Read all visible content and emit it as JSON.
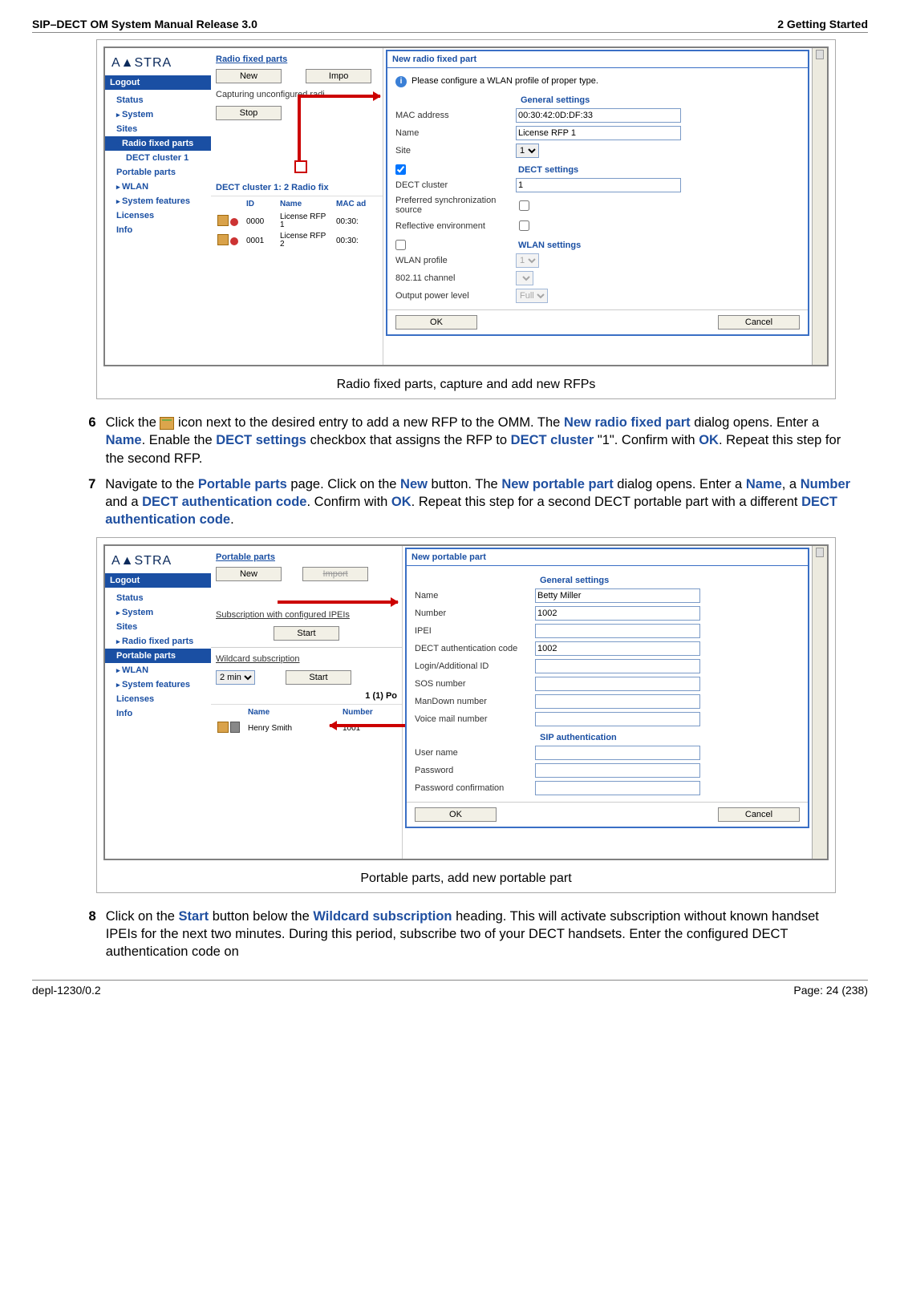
{
  "header": {
    "left": "SIP–DECT OM System Manual Release 3.0",
    "right": "2 Getting Started"
  },
  "footer": {
    "left": "depl-1230/0.2",
    "right": "Page: 24 (238)"
  },
  "fig1": {
    "caption": "Radio fixed parts, capture and add new RFPs",
    "brand": "A▲STRA",
    "logout": "Logout",
    "nav": {
      "status": "Status",
      "system": "System",
      "sites": "Sites",
      "rfp": "Radio fixed parts",
      "dect1": "DECT cluster 1",
      "pp": "Portable parts",
      "wlan": "WLAN",
      "sf": "System features",
      "lic": "Licenses",
      "info": "Info"
    },
    "mid": {
      "title": "Radio fixed parts",
      "new": "New",
      "import": "Impo",
      "capturing": "Capturing unconfigured radi",
      "stop": "Stop",
      "cluster_title": "DECT cluster 1: 2 Radio fix",
      "hdr_id": "ID",
      "hdr_name": "Name",
      "hdr_mac": "MAC ad",
      "rows": [
        {
          "id": "0000",
          "name": "License RFP 1",
          "mac": "00:30:"
        },
        {
          "id": "0001",
          "name": "License RFP 2",
          "mac": "00:30:"
        }
      ]
    },
    "dlg": {
      "title": "New radio fixed part",
      "info": "Please configure a WLAN profile of proper type.",
      "general": "General settings",
      "mac_l": "MAC address",
      "mac_v": "00:30:42:0D:DF:33",
      "name_l": "Name",
      "name_v": "License RFP 1",
      "site_l": "Site",
      "site_v": "1",
      "dect": "DECT settings",
      "cluster_l": "DECT cluster",
      "cluster_v": "1",
      "pref_l": "Preferred synchronization source",
      "refl_l": "Reflective environment",
      "wlan": "WLAN settings",
      "wp_l": "WLAN profile",
      "wp_v": "1",
      "ch_l": "802.11 channel",
      "pw_l": "Output power level",
      "pw_v": "Full",
      "ok": "OK",
      "cancel": "Cancel"
    }
  },
  "step6": {
    "n": "6",
    "t1": "Click the ",
    "t2": " icon next to the desired entry to add a new RFP to the OMM. The ",
    "u1": "New radio fixed part",
    "t3": " dialog opens. Enter a ",
    "u2": "Name",
    "t4": ". Enable the ",
    "u3": "DECT settings",
    "t5": " checkbox that assigns the RFP to ",
    "u4": "DECT cluster",
    "t6": " \"1\". Confirm with ",
    "u5": "OK",
    "t7": ". Repeat this step for the second RFP."
  },
  "step7": {
    "n": "7",
    "t1": "Navigate to the ",
    "u1": "Portable parts",
    "t2": " page. Click on the ",
    "u2": "New",
    "t3": " button. The ",
    "u3": "New portable part",
    "t4": " dialog opens. Enter a ",
    "u4": "Name",
    "t5": ", a ",
    "u5": "Number",
    "t6": " and a ",
    "u6": "DECT authentication code",
    "t7": ". Confirm with ",
    "u7": "OK",
    "t8": ". Repeat this step for a second DECT portable part with a different ",
    "u8": "DECT authentication code",
    "t9": "."
  },
  "fig2": {
    "caption": "Portable parts, add new portable part",
    "brand": "A▲STRA",
    "logout": "Logout",
    "nav": {
      "status": "Status",
      "system": "System",
      "sites": "Sites",
      "rfp": "Radio fixed parts",
      "pp": "Portable parts",
      "wlan": "WLAN",
      "sf": "System features",
      "lic": "Licenses",
      "info": "Info"
    },
    "mid": {
      "title": "Portable parts",
      "new": "New",
      "import": "Import",
      "sub1": "Subscription with configured IPEIs",
      "start": "Start",
      "sub2": "Wildcard subscription",
      "duration": "2 min",
      "count": "1 (1) Po",
      "hdr_name": "Name",
      "hdr_num": "Number",
      "row_name": "Henry Smith",
      "row_num": "1001"
    },
    "dlg": {
      "title": "New portable part",
      "general": "General settings",
      "name_l": "Name",
      "name_v": "Betty Miller",
      "num_l": "Number",
      "num_v": "1002",
      "ipei_l": "IPEI",
      "dac_l": "DECT authentication code",
      "dac_v": "1002",
      "login_l": "Login/Additional ID",
      "sos_l": "SOS number",
      "md_l": "ManDown number",
      "vm_l": "Voice mail number",
      "sip": "SIP authentication",
      "user_l": "User name",
      "pwd_l": "Password",
      "pwdc_l": "Password confirmation",
      "ok": "OK",
      "cancel": "Cancel"
    }
  },
  "step8": {
    "n": "8",
    "t1": "Click on the ",
    "u1": "Start",
    "t2": " button below the ",
    "u2": "Wildcard subscription",
    "t3": " heading. This will activate subscription without known handset IPEIs for the next two minutes. During this period, subscribe two of your DECT handsets. Enter the configured DECT authentication code on"
  }
}
